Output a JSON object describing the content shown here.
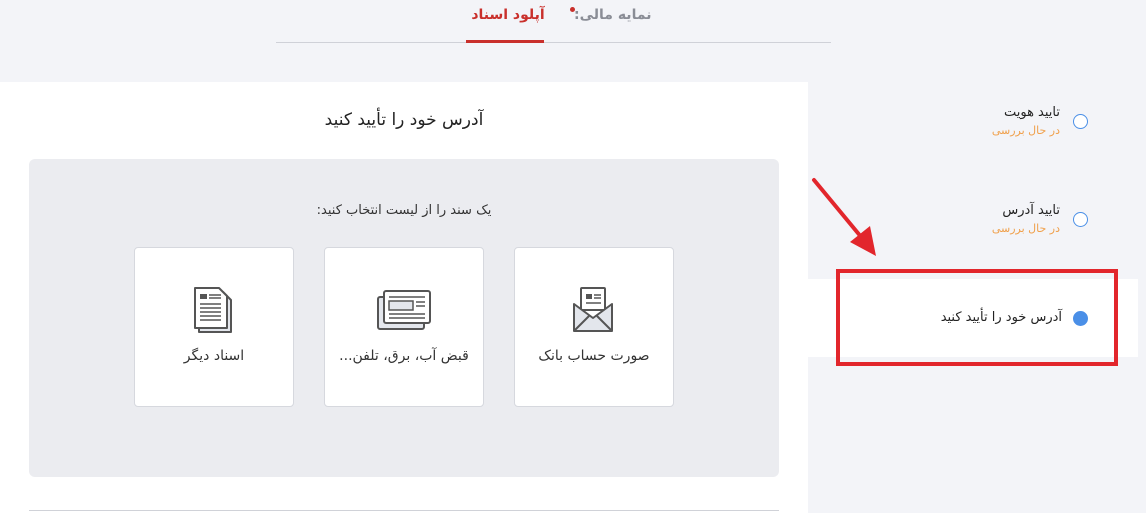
{
  "tabs": {
    "upload": "آپلود اسناد",
    "finance": "نمایه مالی:"
  },
  "main": {
    "title": "آدرس خود را تأیید کنید",
    "prompt": "یک سند را از لیست انتخاب کنید:",
    "documents": [
      {
        "label": "صورت حساب بانک",
        "icon": "envelope-icon"
      },
      {
        "label": "قبض آب، برق، تلفن...",
        "icon": "bill-icon"
      },
      {
        "label": "اسناد دیگر",
        "icon": "document-icon"
      }
    ]
  },
  "steps": [
    {
      "title": "تایید هویت",
      "status": "در حال بررسی"
    },
    {
      "title": "تایید آدرس",
      "status": "در حال بررسی"
    },
    {
      "title": "آدرس خود را تأیید کنید",
      "status": ""
    }
  ],
  "colors": {
    "accent": "#c9302c",
    "step_blue": "#4a8fe7",
    "status_orange": "#f0a04b",
    "highlight_red": "#e2262c"
  }
}
